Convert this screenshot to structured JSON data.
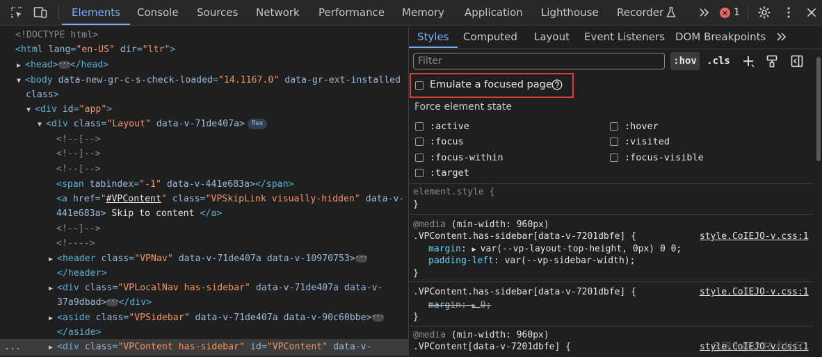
{
  "toolbar": {
    "tabs": [
      "Elements",
      "Console",
      "Sources",
      "Network",
      "Performance",
      "Memory",
      "Application",
      "Lighthouse",
      "Recorder"
    ],
    "error_count": "1"
  },
  "dom": {
    "doctype": "<!DOCTYPE html>",
    "html_open": "<html",
    "html_lang_attr": "lang",
    "html_lang_val": "\"en-US\"",
    "html_dir_attr": "dir",
    "html_dir_val": "\"ltr\"",
    "head_open": "<head>",
    "head_close": "</head>",
    "body_open": "<body",
    "body_attr1": "data-new-gr-c-s-check-loaded",
    "body_val1": "\"14.1167.0\"",
    "body_attr2": "data-gr-ext-installed",
    "body_attr3": "class",
    "div_app_open": "<div",
    "div_app_attr": "id",
    "div_app_val": "\"app\"",
    "div_layout_open": "<div",
    "div_layout_attr": "class",
    "div_layout_val": "\"Layout\"",
    "div_layout_attr2": "data-v-71de407a>",
    "flex_badge": "flex",
    "comment1": "<!--[-->",
    "comment2": "<!--]-->",
    "comment3": "<!--[-->",
    "span_open": "<span",
    "span_attr1": "tabindex",
    "span_val1": "\"-1\"",
    "span_attr2": "data-v-441e683a>",
    "span_close": "</span>",
    "a_open": "<a",
    "a_attr1": "href",
    "a_val1": "#VPContent",
    "a_attr2": "class",
    "a_val2": "\"VPSkipLink visually-hidden\"",
    "a_attr3": "data-v-",
    "a_attr3b": "441e683a>",
    "a_text": "Skip to content",
    "a_close": "</a>",
    "comment4": "<!--]-->",
    "comment5": "<!---->",
    "header_open": "<header",
    "header_attr1": "class",
    "header_val1": "\"VPNav\"",
    "header_attr2": "data-v-71de407a data-v-10970753>",
    "header_close": "</header>",
    "localnav_open": "<div",
    "localnav_attr1": "class",
    "localnav_val1": "\"VPLocalNav has-sidebar\"",
    "localnav_attr2": "data-v-71de407a data-v-",
    "localnav_attr2b": "37a9dbad>",
    "localnav_close": "</div>",
    "aside_open": "<aside",
    "aside_attr1": "class",
    "aside_val1": "\"VPSidebar\"",
    "aside_attr2": "data-v-71de407a data-v-90c60bbe>",
    "aside_close": "</aside>",
    "content_open": "<div",
    "content_attr1": "class",
    "content_val1": "\"VPContent has-sidebar\"",
    "content_attr2": "id",
    "content_val2": "\"VPContent\"",
    "content_attr3": "data-v-",
    "row_dots": "..."
  },
  "styles_tabs": [
    "Styles",
    "Computed",
    "Layout",
    "Event Listeners",
    "DOM Breakpoints"
  ],
  "filter_placeholder": "Filter",
  "hov_label": ":hov",
  "cls_label": ".cls",
  "emulate_label": "Emulate a focused page",
  "force_state_title": "Force element state",
  "states": [
    ":active",
    ":hover",
    ":focus",
    ":visited",
    ":focus-within",
    ":focus-visible",
    ":target"
  ],
  "css": {
    "element_style": "element.style {",
    "close_brace": "}",
    "media1": "@media",
    "media1_query": "(min-width: 960px)",
    "rule1_selector": ".VPContent.has-sidebar[data-v-7201dbfe] {",
    "rule1_source": "style.CoIEJO-v.css:1",
    "rule1_prop1": "margin",
    "rule1_val1": "var(--vp-layout-top-height, 0px) 0 0;",
    "rule1_prop2": "padding-left",
    "rule1_val2": "var(--vp-sidebar-width);",
    "rule2_selector": ".VPContent.has-sidebar[data-v-7201dbfe] {",
    "rule2_source": "style.CoIEJO-v.css:1",
    "rule2_prop1": "margin",
    "rule2_val1": "0;",
    "media2": "@media",
    "media2_query": "(min-width: 960px)",
    "rule3_selector": ".VPContent[data-v-7201dbfe] {",
    "rule3_source": "style.CoIEJO-v.css:1"
  },
  "watermark": "@稀土掘金技术社区"
}
